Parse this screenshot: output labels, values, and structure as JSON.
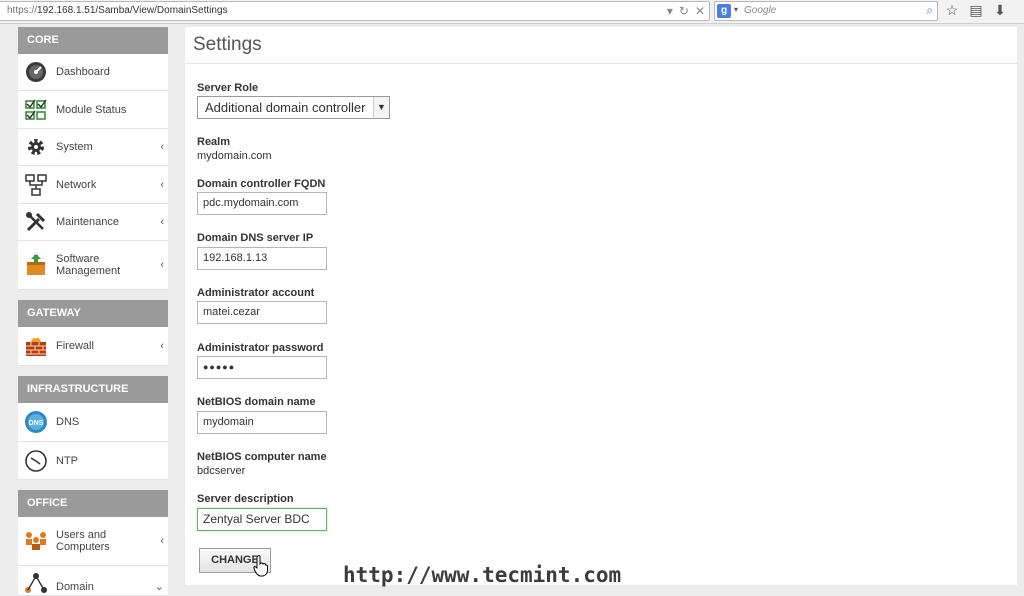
{
  "browser": {
    "url_scheme": "https://",
    "url_rest": "192.168.1.51/Samba/View/DomainSettings",
    "search_placeholder": "Google",
    "search_engine_icon": "google-g-icon"
  },
  "sidebar": {
    "sections": [
      {
        "heading": "CORE",
        "items": [
          {
            "label": "Dashboard",
            "icon": "dashboard-gauge-icon",
            "has_submenu": false
          },
          {
            "label": "Module Status",
            "icon": "checklist-icon",
            "has_submenu": false
          },
          {
            "label": "System",
            "icon": "gear-icon",
            "has_submenu": true
          },
          {
            "label": "Network",
            "icon": "network-icon",
            "has_submenu": true
          },
          {
            "label": "Maintenance",
            "icon": "tools-icon",
            "has_submenu": true
          },
          {
            "label": "Software\nManagement",
            "icon": "package-icon",
            "has_submenu": true
          }
        ]
      },
      {
        "heading": "GATEWAY",
        "items": [
          {
            "label": "Firewall",
            "icon": "firewall-icon",
            "has_submenu": true
          }
        ]
      },
      {
        "heading": "INFRASTRUCTURE",
        "items": [
          {
            "label": "DNS",
            "icon": "dns-globe-icon",
            "has_submenu": false
          },
          {
            "label": "NTP",
            "icon": "clock-icon",
            "has_submenu": false
          }
        ]
      },
      {
        "heading": "OFFICE",
        "items": [
          {
            "label": "Users and\nComputers",
            "icon": "users-icon",
            "has_submenu": true
          },
          {
            "label": "Domain",
            "icon": "domain-icon",
            "has_submenu": true,
            "expanded": true
          }
        ]
      }
    ]
  },
  "main": {
    "title": "Settings",
    "server_role": {
      "label": "Server Role",
      "value": "Additional domain controller"
    },
    "realm": {
      "label": "Realm",
      "value": "mydomain.com"
    },
    "dc_fqdn": {
      "label": "Domain controller FQDN",
      "value": "pdc.mydomain.com"
    },
    "dns_ip": {
      "label": "Domain DNS server IP",
      "value": "192.168.1.13"
    },
    "admin_account": {
      "label": "Administrator account",
      "value": "matei.cezar"
    },
    "admin_password": {
      "label": "Administrator password",
      "value": "●●●●●"
    },
    "netbios_domain": {
      "label": "NetBIOS domain name",
      "value": "mydomain"
    },
    "netbios_computer": {
      "label": "NetBIOS computer name",
      "value": "bdcserver"
    },
    "server_description": {
      "label": "Server description",
      "value": "Zentyal Server BDC"
    },
    "change_button": "CHANGE"
  },
  "watermark": "http://www.tecmint.com"
}
